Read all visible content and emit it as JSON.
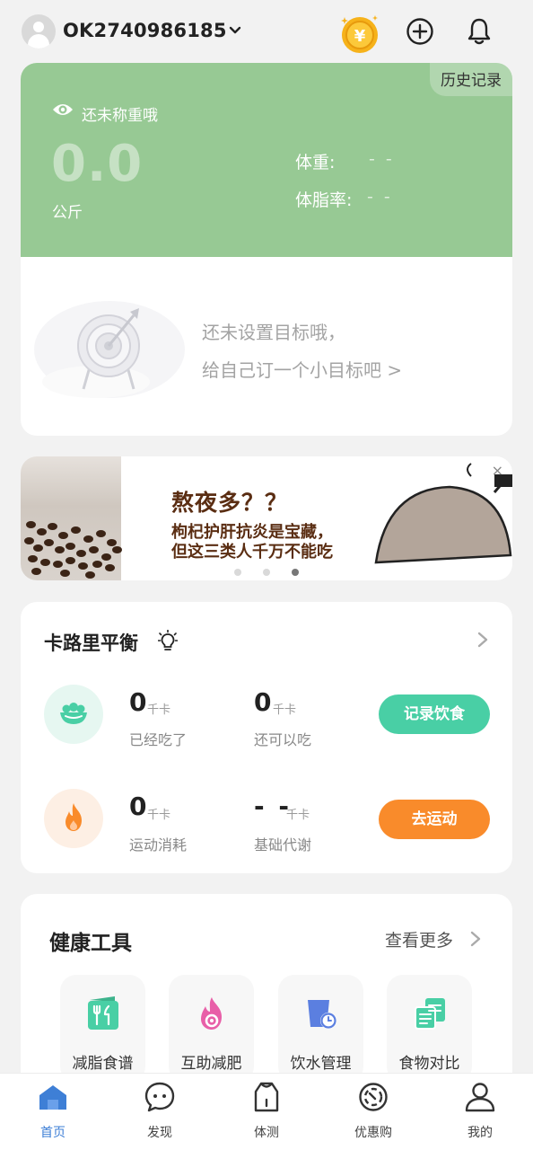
{
  "header": {
    "account_id": "OK2740986185",
    "icons": [
      "avatar",
      "chevron-down-icon",
      "coin-icon",
      "add-icon",
      "bell-icon"
    ]
  },
  "weight_card": {
    "history_label": "历史记录",
    "status": "还未称重哦",
    "weight_value": "0.0",
    "weight_unit": "公斤",
    "metrics": [
      {
        "label": "体重:",
        "value": "- -"
      },
      {
        "label": "体脂率:",
        "value": "- -"
      }
    ],
    "goal_line1": "还未设置目标哦，",
    "goal_line2": "给自己订一个小目标吧 >",
    "color": "#97c994"
  },
  "banner": {
    "headline": "熬夜多？？",
    "line1": "枸杞护肝抗炎是宝藏，",
    "line2": "但这三类人千万不能吃",
    "close": "×",
    "pages": 3,
    "active_page": 3
  },
  "calorie": {
    "title": "卡路里平衡",
    "rows": [
      {
        "icon": "salad-icon",
        "a_value": "0",
        "a_unit": "千卡",
        "a_label": "已经吃了",
        "b_value": "0",
        "b_unit": "千卡",
        "b_label": "还可以吃",
        "button": "记录饮食",
        "color": "#49cfa5"
      },
      {
        "icon": "flame-icon",
        "a_value": "0",
        "a_unit": "千卡",
        "a_label": "运动消耗",
        "b_value": "- -",
        "b_unit": "千卡",
        "b_label": "基础代谢",
        "button": "去运动",
        "color": "#f98b2b"
      }
    ]
  },
  "tools": {
    "title": "健康工具",
    "more": "查看更多",
    "items": [
      {
        "label": "减脂食谱",
        "icon": "recipe-icon"
      },
      {
        "label": "互助减肥",
        "icon": "flame-pink-icon"
      },
      {
        "label": "饮水管理",
        "icon": "water-cup-icon"
      },
      {
        "label": "食物对比",
        "icon": "food-compare-icon"
      }
    ]
  },
  "nav": {
    "items": [
      {
        "label": "首页",
        "icon": "home-icon",
        "active": true
      },
      {
        "label": "发现",
        "icon": "chat-bubble-icon"
      },
      {
        "label": "体测",
        "icon": "body-test-icon"
      },
      {
        "label": "优惠购",
        "icon": "discount-icon"
      },
      {
        "label": "我的",
        "icon": "profile-icon"
      }
    ],
    "active_color": "#3e7fd6"
  }
}
